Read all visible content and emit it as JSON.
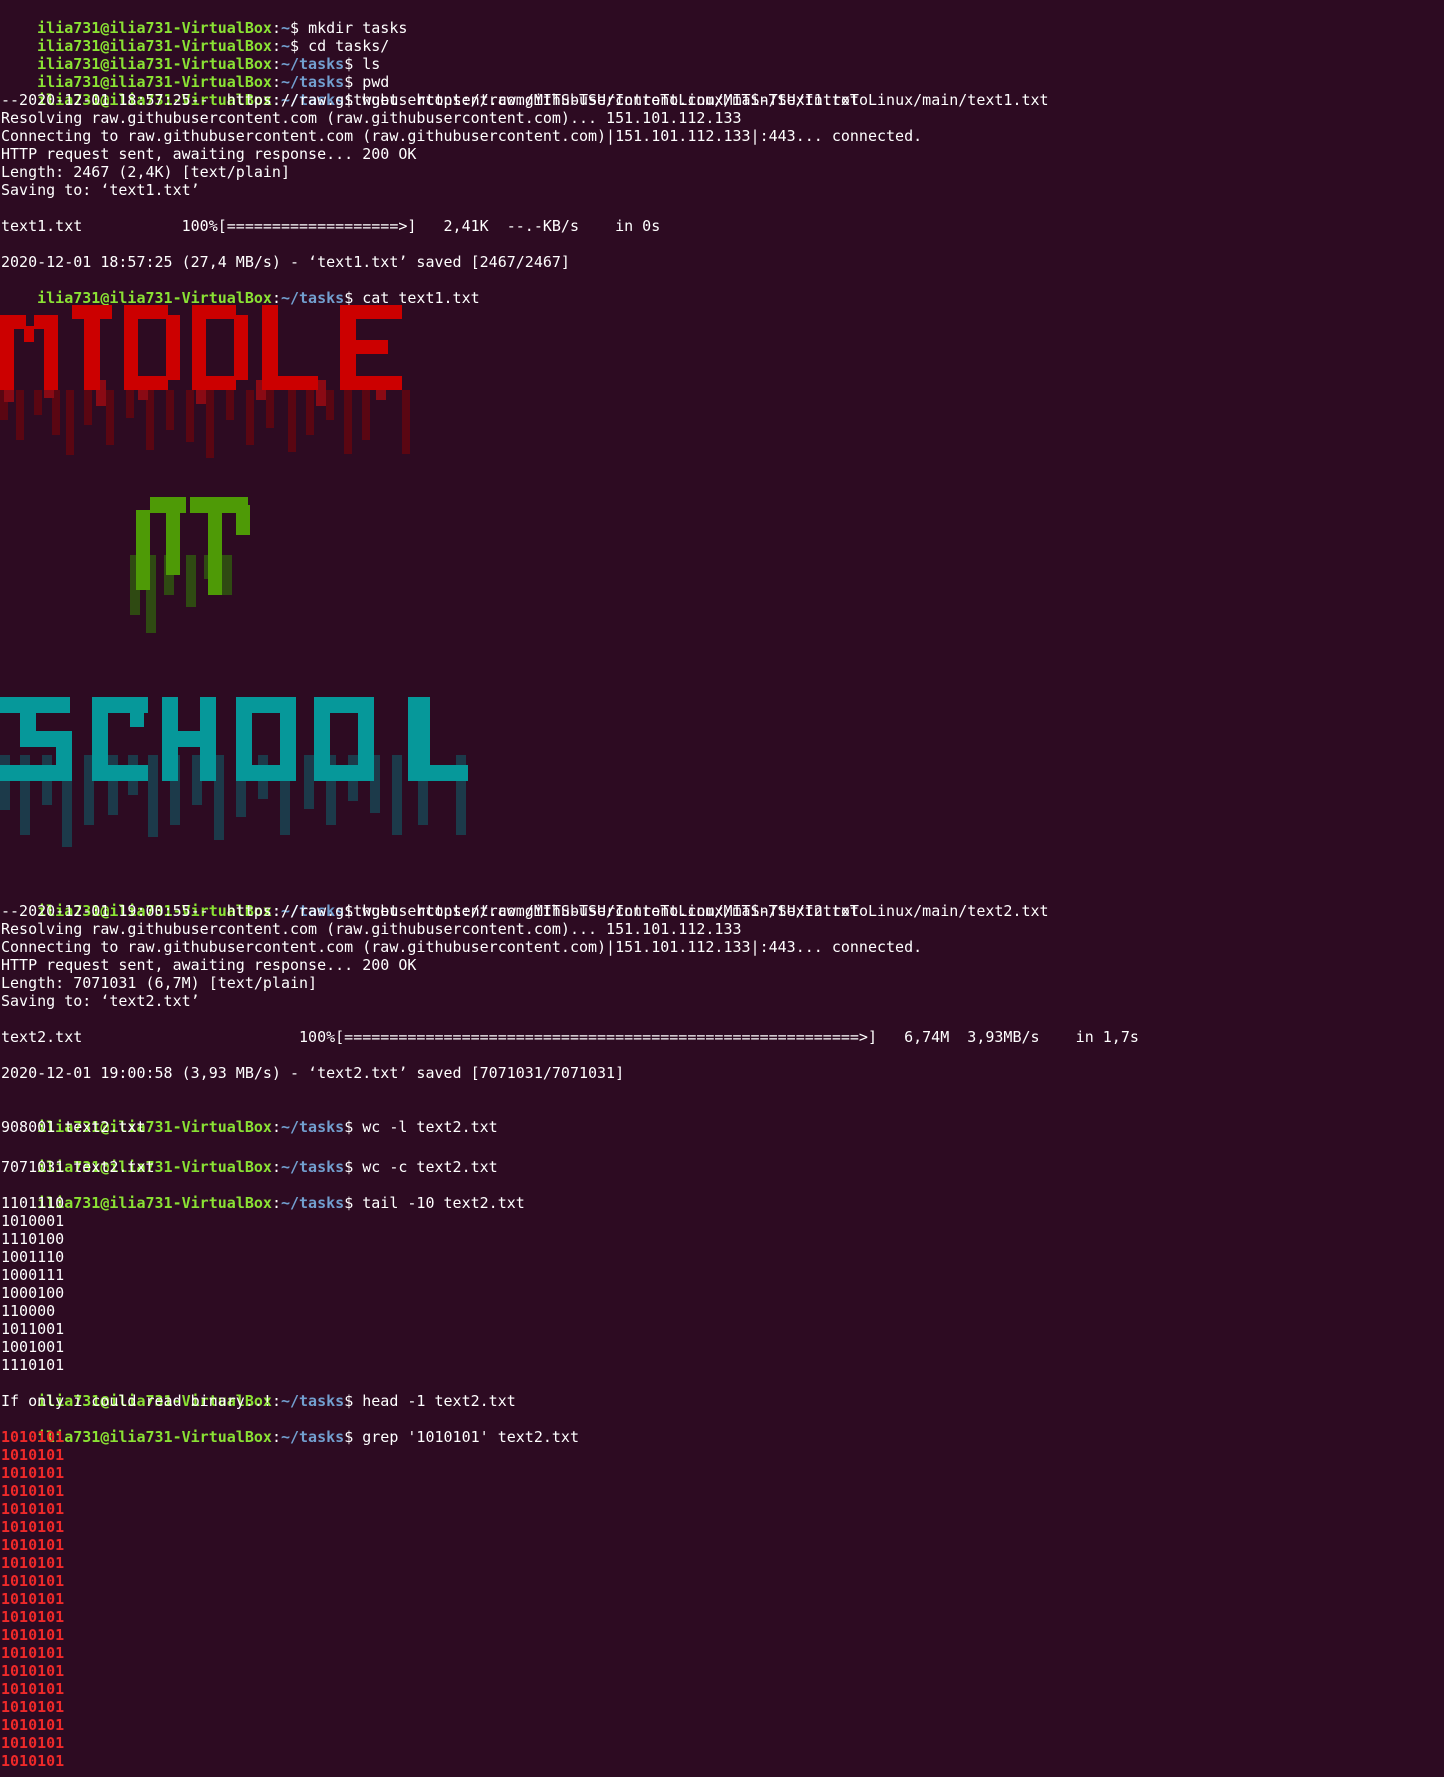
{
  "prompt": {
    "user": "ilia731@ilia731-VirtualBox",
    "home": "~",
    "cwd": "~/tasks",
    "dollar": "$ "
  },
  "commands": {
    "mkdir": "mkdir tasks",
    "cd": "cd tasks/",
    "ls": "ls",
    "pwd": "pwd",
    "wget1": "wget  https://raw.githubusercontent.com/MITS-TSU/IntroToLinux/main/text1.txt",
    "cat": "cat text1.txt",
    "wget2": "wget  https://raw.githubusercontent.com/MITS-TSU/IntroToLinux/main/text2.txt",
    "wc_l": "wc -l text2.txt",
    "wc_c": "wc -c text2.txt",
    "tail": "tail -10 text2.txt",
    "head": "head -1 text2.txt",
    "grep": "grep '1010101' text2.txt"
  },
  "wget1": {
    "start": "--2020-12-01 18:57:25--  https://raw.githubusercontent.com/MITS-TSU/IntroToLinux/main/text1.txt",
    "resolving": "Resolving raw.githubusercontent.com (raw.githubusercontent.com)... 151.101.112.133",
    "connecting": "Connecting to raw.githubusercontent.com (raw.githubusercontent.com)|151.101.112.133|:443... connected.",
    "http": "HTTP request sent, awaiting response... 200 OK",
    "length": "Length: 2467 (2,4K) [text/plain]",
    "saving": "Saving to: ‘text1.txt’",
    "progress": "text1.txt           100%[===================>]   2,41K  --.-KB/s    in 0s",
    "saved": "2020-12-01 18:57:25 (27,4 MB/s) - ‘text1.txt’ saved [2467/2467]"
  },
  "wget2": {
    "start": "--2020-12-01 19:00:55--  https://raw.githubusercontent.com/MITS-TSU/IntroToLinux/main/text2.txt",
    "resolving": "Resolving raw.githubusercontent.com (raw.githubusercontent.com)... 151.101.112.133",
    "connecting": "Connecting to raw.githubusercontent.com (raw.githubusercontent.com)|151.101.112.133|:443... connected.",
    "http": "HTTP request sent, awaiting response... 200 OK",
    "length": "Length: 7071031 (6,7M) [text/plain]",
    "saving": "Saving to: ‘text2.txt’",
    "progress": "text2.txt                        100%[=========================================================>]   6,74M  3,93MB/s    in 1,7s",
    "saved": "2020-12-01 19:00:58 (3,93 MB/s) - ‘text2.txt’ saved [7071031/7071031]"
  },
  "wc_l_out": "908001 text2.txt",
  "wc_c_out": "7071031 text2.txt",
  "tail_out": [
    "1101110",
    "1010001",
    "1110100",
    "1001110",
    "1000111",
    "1000100",
    "110000",
    "1011001",
    "1001001",
    "1110101"
  ],
  "head_out": "If only i could read binary..!",
  "grep_out": [
    "1010101",
    "1010101",
    "1010101",
    "1010101",
    "1010101",
    "1010101",
    "1010101",
    "1010101",
    "1010101",
    "1010101",
    "1010101",
    "1010101",
    "1010101",
    "1010101",
    "1010101",
    "1010101",
    "1010101",
    "1010101",
    "1010101"
  ],
  "art": {
    "word1": "MIDDLE",
    "word2": "IT",
    "word3": "SCHOOL",
    "color1": "#cc0000",
    "color2": "#4e9a06",
    "color3": "#06989a"
  },
  "colors": {
    "background": "#2d0b22",
    "user": "#8ae234",
    "path": "#729fcf",
    "match": "#ef2929"
  }
}
